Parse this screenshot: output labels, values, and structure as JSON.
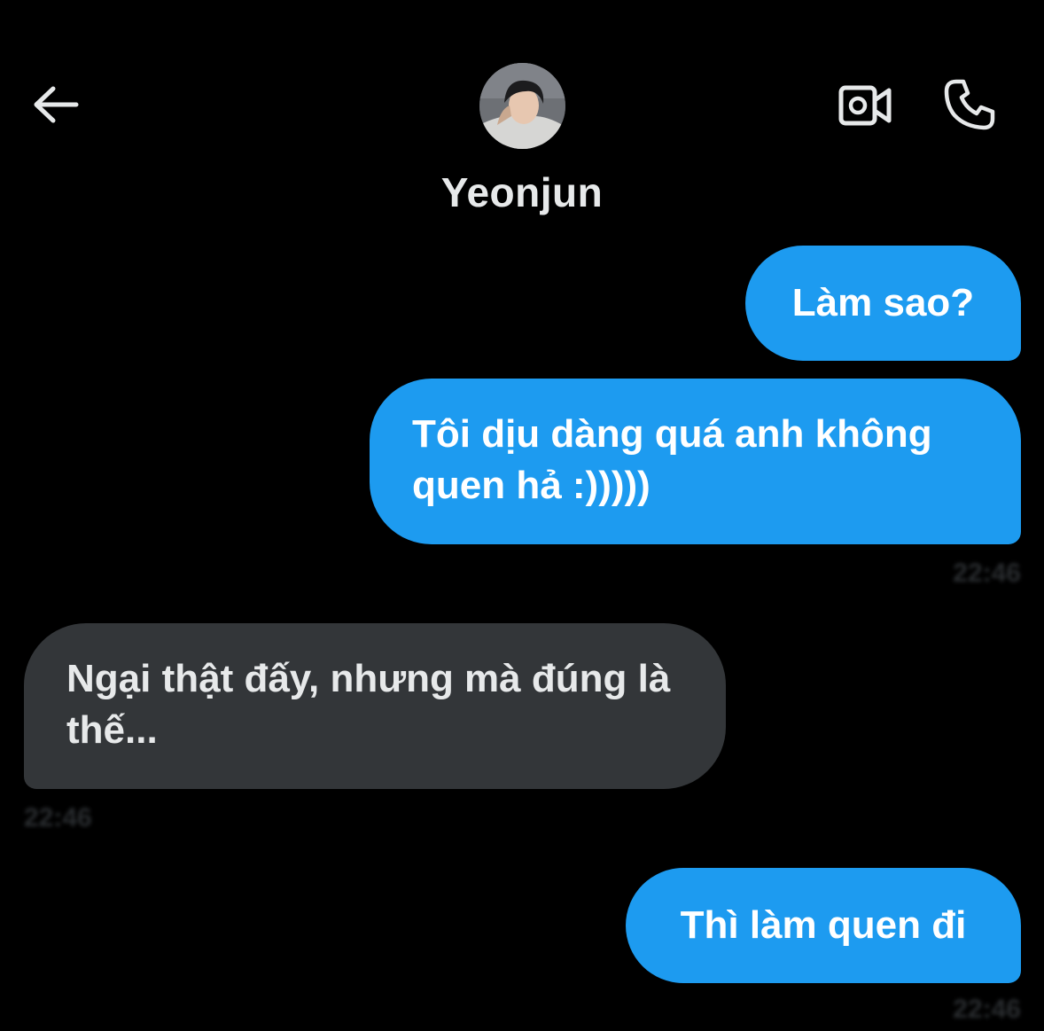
{
  "header": {
    "contact_name": "Yeonjun",
    "back_icon": "arrow-left-icon",
    "video_icon": "video-call-icon",
    "phone_icon": "phone-icon"
  },
  "messages": [
    {
      "direction": "sent",
      "text": "Làm sao?"
    },
    {
      "direction": "sent",
      "text": "Tôi dịu dàng quá anh không quen hả :)))))",
      "timestamp": "22:46"
    },
    {
      "direction": "received",
      "text": "Ngại thật đấy, nhưng mà đúng là thế...",
      "timestamp": "22:46"
    },
    {
      "direction": "sent",
      "text": "Thì làm quen đi",
      "timestamp": "22:46"
    }
  ],
  "colors": {
    "background": "#000000",
    "sent_bubble": "#1d9bf0",
    "received_bubble": "#333639",
    "text": "#e7e9ea"
  }
}
